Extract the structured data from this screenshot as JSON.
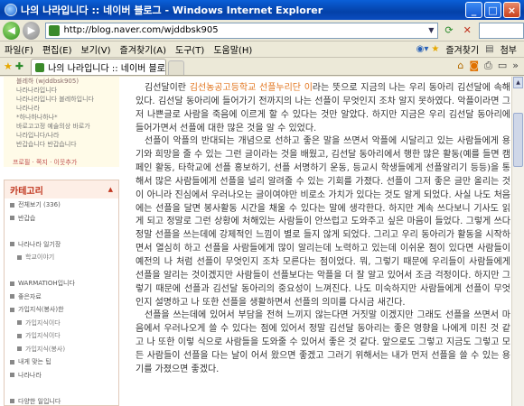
{
  "window": {
    "title": "나의 나라입니다 :: 네이버 블로그 - Windows Internet Explorer",
    "buttons": {
      "minimize": "_",
      "maximize": "□",
      "close": "×"
    }
  },
  "address": {
    "url": "http://blog.naver.com/wjddbsk905"
  },
  "menu": {
    "items": [
      "파일(F)",
      "편집(E)",
      "보기(V)",
      "즐겨찾기(A)",
      "도구(T)",
      "도움말(H)"
    ],
    "favorites": "즐겨찾기",
    "tools_label": "첨부"
  },
  "tab": {
    "label": "나의 나라입니다 :: 네이버 블로그"
  },
  "sidebar": {
    "profile_lines": [
      "블레하 (wjddbsk905)",
      "나라나라입니다",
      "나라나라입니다 블레하입니다",
      "나라나라",
      "*하나하나하나*",
      "바로고고정 예술의상 바로가",
      "나라입니다/나라",
      "반갑습니다 반갑습니다"
    ],
    "profile_links": "프로필 · 쪽지 · 이웃추가",
    "categories_title": "카테고리",
    "categories": [
      {
        "label": "전체보기 (336)",
        "sub": false
      },
      {
        "label": "반갑습",
        "sub": false
      },
      {
        "label": "",
        "sub": false
      },
      {
        "label": "나라나라 일기장",
        "sub": false
      },
      {
        "label": "학교이야기",
        "sub": true
      },
      {
        "label": "",
        "sub": false
      },
      {
        "label": "WARMATIOH입니다",
        "sub": false
      },
      {
        "label": "좋은자료",
        "sub": false
      },
      {
        "label": "가입지식(봉사)한",
        "sub": false
      },
      {
        "label": "가입지식이다",
        "sub": true
      },
      {
        "label": "가입지식이다",
        "sub": true
      },
      {
        "label": "가입지식(봉사)",
        "sub": true
      },
      {
        "label": "내게 맞는 팁",
        "sub": false
      },
      {
        "label": "나라나라",
        "sub": false
      },
      {
        "label": "",
        "sub": false
      },
      {
        "label": "다양한 일입니다",
        "sub": false
      }
    ]
  },
  "article": {
    "paragraphs": [
      {
        "before": "김선달이란 ",
        "highlight": "김선농공고등학교 선플누리단 이",
        "after": "라는 뜻으로 지금의 나는 우리 동아리 김선달에 속해 있다. 김선달 동아리에 들어가기 전까지의 나는 선플이 무엇인지 조차 알지 못하였다. 악플이라면 그저 나쁜글로 사람을 죽음에 이르게 할 수 있다는 것만 알았다. 하지만 지금은 우리 김선달 동아리에 들어가면서 선플에 대한 많은 것을 알 수 있었다."
      },
      {
        "before": "선플이 악플의 반대되는 개념으로 선하고 좋은 말을 쓰면서 악플에 시달리고 있는 사람들에게 용기와 희망을 줄 수 있는 그런 글이라는 것을 배웠고, 김선달 동아리에서 행한 많은 활동(예를 들면 캠페인 활동, 타학교에 선플 홍보하기, 선플 서명하기 운동, 등교시 학생들에게 선플알리기 등등)을 통해서 많은 사람들에게 선플을 널리 알려줄 수 있는 기회를 가졌다. 선플이 그저 좋은 글만 올리는 것이 아니라 진심에서 우러나오는 글이여야만 비로소 가치가 있다는 것도 알게 되었다. 사실 나도 처음에는 선플을 달면 봉사활동 시간을 채울 수 있다는 말에 생각한다. 하지만 계속 쓰다보니 기사도 읽게 되고 정말로 그런 상황에 처해있는 사람들이 안쓰럽고 도와주고 싶은 마음이 들었다. 그렇게 쓰다 정말 선플을 쓰는데에 강제적인 느낌이 별로 들지 않게 되었다. 그리고 우리 동아리가 활동을 시작하면서 열심히 하고 선플을 사람들에게 많이 알리는데 노력하고 있는데 이쉬운 점이 있다면 사람들이 예전의 나 처럼 선플이 무엇인지 조차 모른다는 점이었다. 뭐, 그렇기 때문에 우리들이 사람들에게 선플을 알리는 것이겠지만 사람들이 선플보다는 악플을 더 잘 알고 있어서 조금 걱정이다. 하지만 그렇기 때문에 선플과 김선달 동아리의 중요성이 느껴진다. 나도 미숙하지만 사람들에게 선플이 무엇인지 설명하고 나 또한 선플을 생활하면서 선플의 의미를 다시금 새긴다.",
        "highlight": "",
        "after": ""
      },
      {
        "before": "선플을 쓰는데에 있어서 부담을 전혀 느끼지 않는다면 거짓말 이겠지만 그래도 선플을 쓰면서 마음에서 우러나오게 쓸 수 있다는 점에 있어서 정말 김선달 동아리는 좋은 영향을 나에게 미친 것 같고 나 또한 이렇 식으로 사람들을 도와줄 수 있어서 좋은 것 같다. 앞으로도 그렇고 지금도 그렇고 모든 사람들이 선플을 다는 날이 어서 왔으면 좋겠고 그러기 위해서는 내가 먼저 선플을 쓸 수 있는 용기를 가졌으면 좋겠다.",
        "highlight": "",
        "after": ""
      }
    ]
  }
}
